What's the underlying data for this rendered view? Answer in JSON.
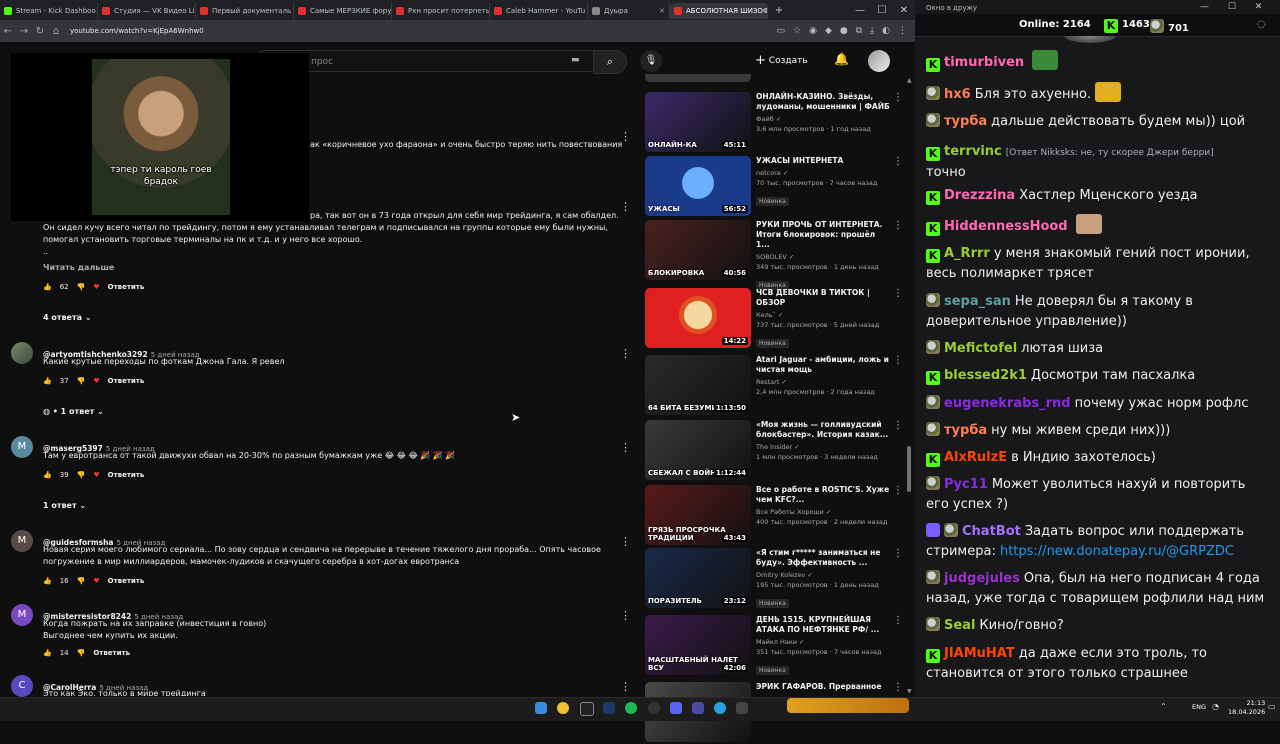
{
  "browser": {
    "tabs": [
      {
        "label": "Stream - Kick Dashboo",
        "color": "#53fc18"
      },
      {
        "label": "Студия — VK Видео Li",
        "color": "#e03030"
      },
      {
        "label": "Первый документаль",
        "color": "#e03030"
      },
      {
        "label": "Самые МЕРЗКИЕ фору",
        "color": "#e03030"
      },
      {
        "label": "Рхн просит потерпеть",
        "color": "#e03030"
      },
      {
        "label": "Caleb Hammer - YouTu",
        "color": "#e03030"
      },
      {
        "label": "Дуыра",
        "color": "#888888"
      },
      {
        "label": "АБСОЛЮТНАЯ ШИЗОФ",
        "color": "#e03030"
      }
    ],
    "url": "youtube.com/watch?v=KjEpA6Wnhw0",
    "window": {
      "minimize": "—",
      "maximize": "☐",
      "close": "✕"
    }
  },
  "youtube": {
    "search_placeholder": "прос",
    "create_label": "Создать",
    "pip_caption": "тэпер ти кароль гоев брадок"
  },
  "comments": {
    "c0_partial_text": "ак «коричневое ухо фараона» и очень быстро теряю нить повествования",
    "c1": {
      "lines": [
        "ра, так вот он в 73 года открыл для себя мир трейдинга, я сам обалдел.",
        "Он сидел кучу всего читал по трейдингу, потом я ему устанавливал телеграм и подписывался на группы которые ему были нужны,",
        "помогал установить торговые терминалы на пк и т.д. и у него все хорошо.",
        ".."
      ],
      "read_more": "Читать дальше",
      "likes": "62",
      "reply": "Ответить",
      "replies_toggle": "4 ответа"
    },
    "c2": {
      "author": "@artyomtishchenko3292",
      "time": "5 дней назад",
      "text": "Какие крутые переходы по фоткам Джона Гала. Я ревел",
      "likes": "37",
      "reply": "Ответить",
      "replies_toggle": "1 ответ"
    },
    "c3": {
      "author": "@maserg5397",
      "time": "5 дней назад",
      "avatar_letter": "M",
      "text": "Там у евротранса от такой движухи обвал на 20-30% по разным бумажкам уже 😂 😂 😂 🎉 🎉 🎉",
      "likes": "39",
      "reply": "Ответить",
      "replies_toggle": "1 ответ"
    },
    "c4": {
      "author": "@guidesformsha",
      "time": "5 дней назад",
      "avatar_letter": "M",
      "lines": [
        "Новая серия моего любимого сериала... По зову сердца и сендвича на перерыве в течение тяжелого дня прораба... Опять часовое",
        "погружение в мир миллиардеров, мамочек-лудиков и скачущего серебра в хот-догах евротранса"
      ],
      "likes": "16",
      "reply": "Ответить"
    },
    "c5": {
      "author": "@misterresistor8242",
      "time": "5 дней назад",
      "avatar_letter": "M",
      "lines": [
        "Когда пожрать на их заправке (инвестиция в говно)",
        "Выгоднее чем купить их акции."
      ],
      "likes": "14",
      "reply": "Ответить"
    },
    "c6": {
      "author": "@CarolHerra",
      "time": "5 дней назад",
      "avatar_letter": "C",
      "text": "Это как Эко, только в мире трейдинга"
    }
  },
  "recommended": [
    {
      "title1": "ОНЛАЙН-КАЗИНО. Звёзды,",
      "title2": "лудоманы, мошенники | ФАЙБ",
      "channel": "Файб",
      "stats": "3,6 млн просмотров · 1 год назад",
      "duration": "45:11",
      "thumb_text": "ОНЛАЙН-КА",
      "bg": "#3a2a6a",
      "new": ""
    },
    {
      "title1": "УЖАСЫ ИНТЕРНЕТА",
      "title2": "",
      "channel": "netcore",
      "stats": "70 тыс. просмотров · 7 часов назад",
      "duration": "56:52",
      "thumb_text": "УЖАСЫ",
      "bg": "#1a3a8a",
      "new": "Новинка"
    },
    {
      "title1": "РУКИ ПРОЧЬ ОТ ИНТЕРНЕТА.",
      "title2": "Итоги блокировок: прошёл 1...",
      "channel": "SOBOLEV",
      "stats": "349 тыс. просмотров · 1 день назад",
      "duration": "40:56",
      "thumb_text": "БЛОКИРОВКА",
      "bg": "#4a2020",
      "new": "Новинка"
    },
    {
      "title1": "ЧСВ ДЕВОЧКИ В ТИКТОК |",
      "title2": "ОБЗОР",
      "channel": "Кельˇ",
      "stats": "737 тыс. просмотров · 5 дней назад",
      "duration": "14:22",
      "thumb_text": "",
      "bg": "#e02020",
      "new": "Новинка"
    },
    {
      "title1": "Atari Jaguar - амбиции, ложь и",
      "title2": "чистая мощь",
      "channel": "Restart",
      "stats": "2,4 млн просмотров · 2 года назад",
      "duration": "1:13:50",
      "thumb_text": "64 БИТА БЕЗУМИЯ",
      "bg": "#2a2a2a",
      "new": ""
    },
    {
      "title1": "«Моя жизнь — голливудский",
      "title2": "блокбастер». История казак...",
      "channel": "The Insider",
      "stats": "1 млн просмотров · 3 недели назад",
      "duration": "1:12:44",
      "thumb_text": "СБЕЖАЛ С ВОЙНЫ",
      "bg": "#3a3a3a",
      "new": ""
    },
    {
      "title1": "Все о работе в ROSTIC'S. Хуже",
      "title2": "чем KFC?...",
      "channel": "Все Работы Хороши",
      "stats": "400 тыс. просмотров · 2 недели назад",
      "duration": "43:43",
      "thumb_text": "ГРЯЗЬ ПРОСРОЧКА ТРАДИЦИИ",
      "bg": "#5a1a1a",
      "new": ""
    },
    {
      "title1": "«Я стим г***** заниматься не",
      "title2": "буду». Эффективность ...",
      "channel": "Dmitry Kolezev",
      "stats": "195 тыс. просмотров · 1 день назад",
      "duration": "23:12",
      "thumb_text": "ПОРАЗИТЕЛЬ",
      "bg": "#1a2a4a",
      "new": "Новинка"
    },
    {
      "title1": "ДЕНЬ 1515. КРУПНЕЙШАЯ",
      "title2": "АТАКА ПО НЕФТЯНКЕ РФ/ ...",
      "channel": "Майкл Наки",
      "stats": "351 тыс. просмотров · 7 часов назад",
      "duration": "42:06",
      "thumb_text": "МАСШТАБНЫЙ НАЛЕТ ВСУ",
      "bg": "#3a1a4a",
      "new": "Новинка"
    },
    {
      "title1": "ЭРИК ГАФАРОВ. Прерванное",
      "title2": "",
      "channel": "",
      "stats": "",
      "duration": "",
      "thumb_text": "",
      "bg": "#4a4a4a",
      "new": ""
    }
  ],
  "chat": {
    "window_title": "Окно в дружу",
    "online_label": "Online:",
    "online_count": "2164",
    "kick_count": "1463",
    "other_count": "701",
    "messages": [
      {
        "nick": "timurbiven",
        "color": "#ff69b4",
        "badge": "k",
        "text": "",
        "emoji": "#3a8a3a"
      },
      {
        "nick": "hx6",
        "color": "#ff7f50",
        "badge": "u",
        "text": "Бля это ахуенно.",
        "emoji": "#e0b020"
      },
      {
        "nick": "турба",
        "color": "#ff7f50",
        "badge": "u",
        "text": "дальше действовать будем мы)) цой",
        "emoji": ""
      },
      {
        "nick": "terrvinc",
        "color": "#9acd32",
        "badge": "k",
        "reply": "[Ответ Nikksks: не, ту скорее Джери берри]",
        "text": "точно",
        "emoji": ""
      },
      {
        "nick": "Drezzzina",
        "color": "#ff69b4",
        "badge": "k",
        "text": "Хастлер Мценского уезда",
        "emoji": ""
      },
      {
        "nick": "HiddennessHood",
        "color": "#ff69b4",
        "badge": "k",
        "text": "",
        "emoji": "#c8a080"
      },
      {
        "nick": "A_Rrrr",
        "color": "#9acd32",
        "badge": "k",
        "text": "у меня знакомый гений пост иронии, весь полимаркет трясет",
        "emoji": ""
      },
      {
        "nick": "sepa_san",
        "color": "#5f9ea0",
        "badge": "u",
        "text": "Не доверял бы я такому в доверительное управление))",
        "emoji": ""
      },
      {
        "nick": "Mefictofel",
        "color": "#9acd32",
        "badge": "u",
        "text": "лютая шиза",
        "emoji": ""
      },
      {
        "nick": "blessed2k1",
        "color": "#9acd32",
        "badge": "k",
        "text": "Досмотри там пасхалка",
        "emoji": ""
      },
      {
        "nick": "eugenekrabs_rnd",
        "color": "#8a2be2",
        "badge": "u",
        "text": "почему ужас норм рофлс",
        "emoji": ""
      },
      {
        "nick": "турба",
        "color": "#ff7f50",
        "badge": "u",
        "text": "ну мы живем среди них)))",
        "emoji": ""
      },
      {
        "nick": "AlxRulzE",
        "color": "#ff4500",
        "badge": "k",
        "text": "в Индию захотелось)",
        "emoji": ""
      },
      {
        "nick": "Рус11",
        "color": "#8a2be2",
        "badge": "u",
        "text": "Может уволиться нахуй и повторить его успех ?)",
        "emoji": ""
      },
      {
        "nick": "ChatBot",
        "color": "#a970ff",
        "badge": "bot",
        "text": "Задать вопрос или поддержать стримера:",
        "link": "https://new.donatepay.ru/@GRPZDC",
        "emoji": ""
      },
      {
        "nick": "judgejules",
        "color": "#9932cc",
        "badge": "u",
        "text": "Опа, был на него подписан 4 года назад, уже тогда с товарищем рофлили над ним",
        "emoji": ""
      },
      {
        "nick": "Seal",
        "color": "#9acd32",
        "badge": "u",
        "text": "Кино/говно?",
        "emoji": ""
      },
      {
        "nick": "JIAMuHAT",
        "color": "#ff4500",
        "badge": "k",
        "text": "да даже если это троль, то становится от этого только страшнее",
        "emoji": ""
      }
    ]
  },
  "taskbar": {
    "lang": "ENG",
    "time": "21:13",
    "date": "18.04.2026"
  }
}
